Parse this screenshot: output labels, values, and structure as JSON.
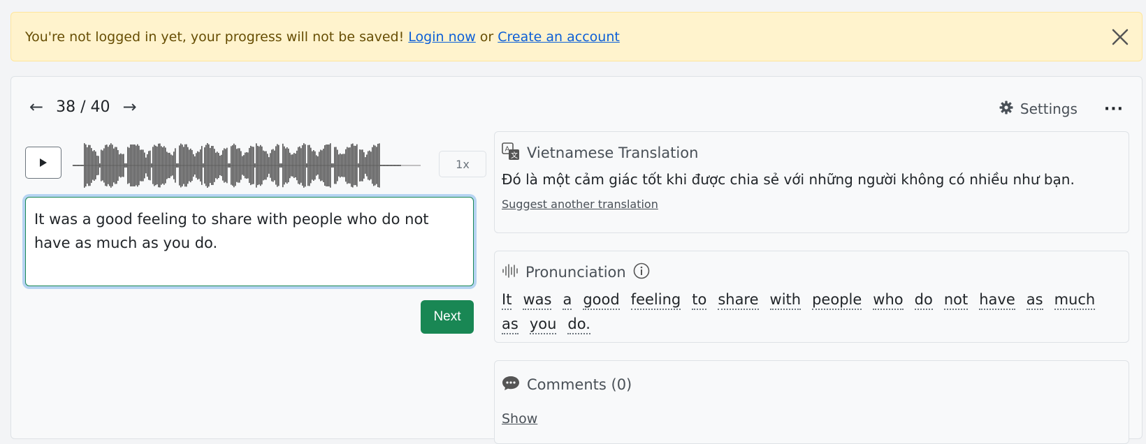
{
  "alert": {
    "message": "You're not logged in yet, your progress will not be saved!",
    "login_link": "Login now",
    "separator": "or",
    "create_link": "Create an account"
  },
  "nav": {
    "counter": "38 / 40"
  },
  "toolbar": {
    "settings_label": "Settings"
  },
  "player": {
    "speed_label": "1x"
  },
  "answer": {
    "value": "It was a good feeling to share with people who do not have as much as you do."
  },
  "next_label": "Next",
  "translation": {
    "title": "Vietnamese Translation",
    "text": "Đó là một cảm giác tốt khi được chia sẻ với những người không có nhiều như bạn.",
    "suggest_label": "Suggest another translation"
  },
  "pronunciation": {
    "title": "Pronunciation",
    "words": [
      "It",
      "was",
      "a",
      "good",
      "feeling",
      "to",
      "share",
      "with",
      "people",
      "who",
      "do",
      "not",
      "have",
      "as",
      "much",
      "as",
      "you",
      "do."
    ]
  },
  "comments": {
    "title": "Comments (0)",
    "show_label": "Show"
  },
  "colors": {
    "alert_bg": "#fff3cd",
    "link": "#0b5ed7",
    "accent_green": "#198754",
    "focus_ring": "#b6d4f2"
  }
}
